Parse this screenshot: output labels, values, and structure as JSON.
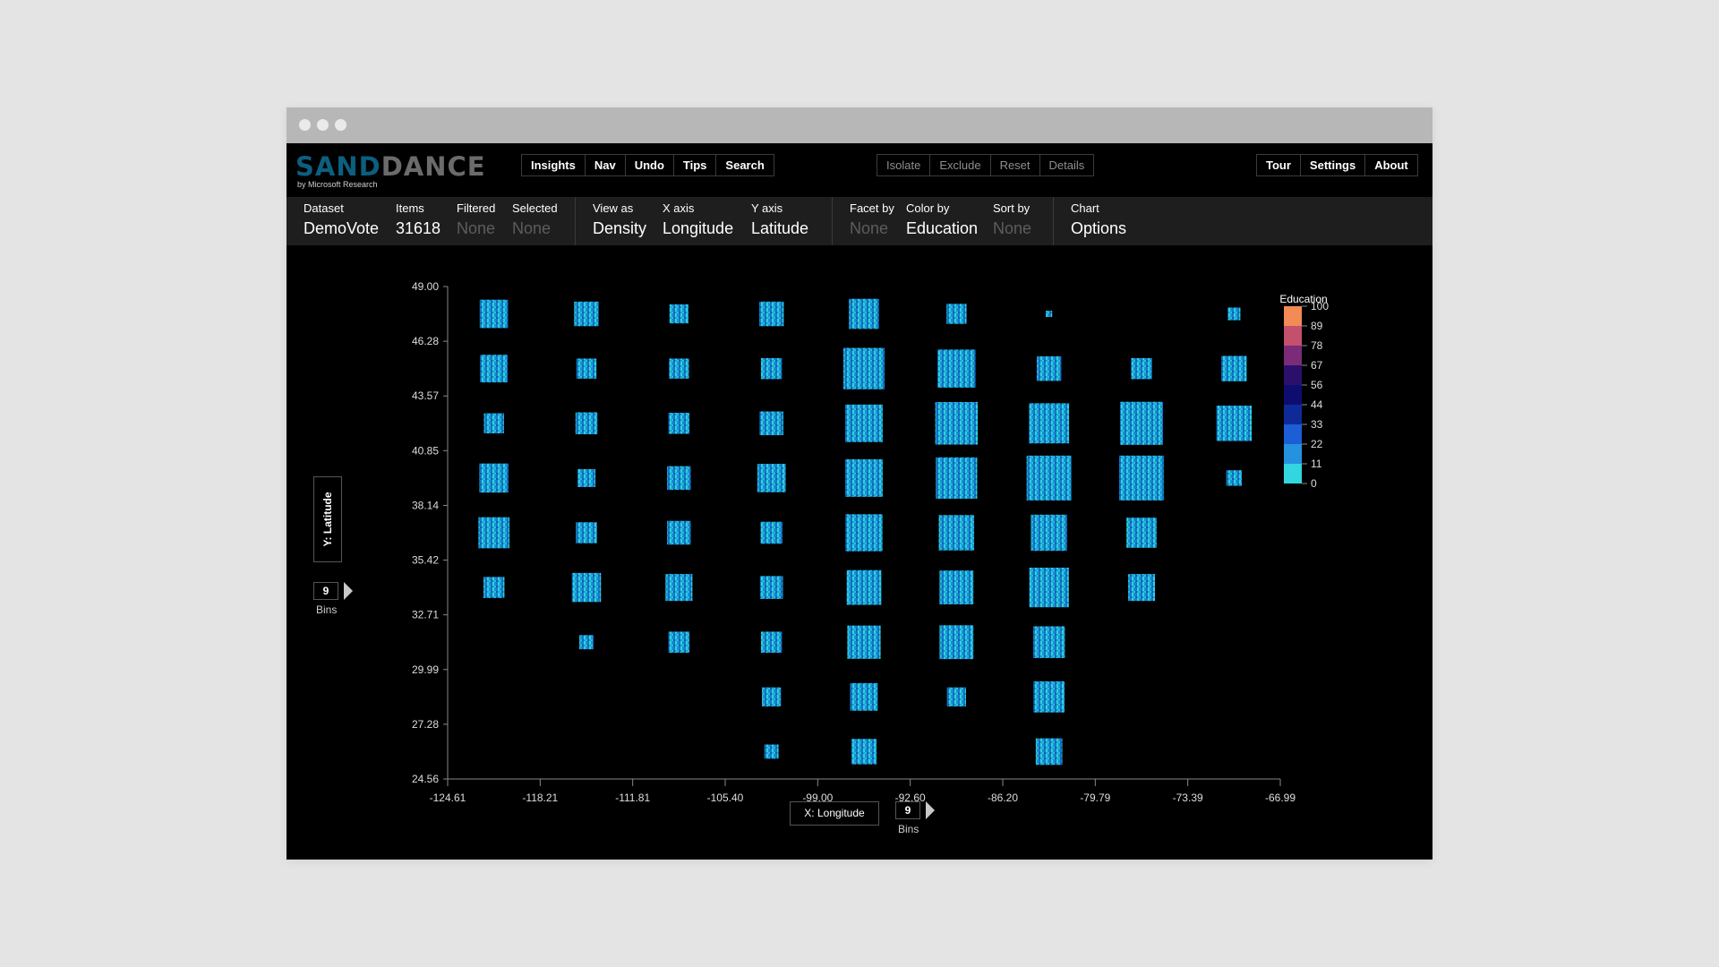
{
  "app": {
    "logo_part1": "SAND",
    "logo_part2": "DANCE",
    "logo_sub": "by Microsoft Research"
  },
  "nav_buttons": [
    "Insights",
    "Nav",
    "Undo",
    "Tips",
    "Search"
  ],
  "selection_buttons": [
    "Isolate",
    "Exclude",
    "Reset",
    "Details"
  ],
  "right_buttons": [
    "Tour",
    "Settings",
    "About"
  ],
  "toolbar": {
    "dataset": {
      "label": "Dataset",
      "value": "DemoVote"
    },
    "items": {
      "label": "Items",
      "value": "31618"
    },
    "filtered": {
      "label": "Filtered",
      "value": "None"
    },
    "selected": {
      "label": "Selected",
      "value": "None"
    },
    "view_as": {
      "label": "View as",
      "value": "Density"
    },
    "x_axis": {
      "label": "X axis",
      "value": "Longitude"
    },
    "y_axis": {
      "label": "Y axis",
      "value": "Latitude"
    },
    "facet_by": {
      "label": "Facet by",
      "value": "None"
    },
    "color_by": {
      "label": "Color by",
      "value": "Education"
    },
    "sort_by": {
      "label": "Sort by",
      "value": "None"
    },
    "chart": {
      "label": "Chart",
      "value": "Options"
    }
  },
  "axes": {
    "y_button": "Y: Latitude",
    "x_button": "X: Longitude",
    "y_bins": "9",
    "x_bins": "9",
    "bins_label": "Bins"
  },
  "colors": {
    "legend_scale": [
      "#f28b55",
      "#c4506e",
      "#7a2c78",
      "#2a106b",
      "#0d0d70",
      "#0f2a98",
      "#1c5ed6",
      "#2592e0",
      "#33d6e0"
    ]
  },
  "chart_data": {
    "type": "heatmap",
    "chart_style": "binned density squares",
    "xlabel": "X: Longitude",
    "ylabel": "Y: Latitude",
    "x_ticks": [
      "-124.61",
      "-118.21",
      "-111.81",
      "-105.40",
      "-99.00",
      "-92.60",
      "-86.20",
      "-79.79",
      "-73.39",
      "-66.99"
    ],
    "y_ticks": [
      "49.00",
      "46.28",
      "43.57",
      "40.85",
      "38.14",
      "35.42",
      "32.71",
      "29.99",
      "27.28",
      "24.56"
    ],
    "xlim": [
      -124.61,
      -66.99
    ],
    "ylim": [
      24.56,
      49.0
    ],
    "legend": {
      "title": "Education",
      "labels": [
        "100",
        "89",
        "78",
        "67",
        "56",
        "44",
        "33",
        "22",
        "11",
        "0"
      ]
    },
    "cells_note": "relative item density per bin, 0-1; row 0 = top latitude bin, col 0 = westmost bin",
    "cells": [
      [
        0.4,
        0.3,
        0.18,
        0.3,
        0.45,
        0.2,
        0.02,
        0.0,
        0.08
      ],
      [
        0.38,
        0.2,
        0.2,
        0.22,
        0.85,
        0.72,
        0.3,
        0.22,
        0.32
      ],
      [
        0.2,
        0.24,
        0.22,
        0.28,
        0.7,
        0.9,
        0.8,
        0.92,
        0.62
      ],
      [
        0.42,
        0.16,
        0.28,
        0.4,
        0.7,
        0.85,
        1.0,
        1.0,
        0.12
      ],
      [
        0.48,
        0.22,
        0.28,
        0.24,
        0.68,
        0.62,
        0.65,
        0.45,
        0.0
      ],
      [
        0.22,
        0.42,
        0.36,
        0.26,
        0.6,
        0.57,
        0.78,
        0.36,
        0.0
      ],
      [
        0.0,
        0.1,
        0.22,
        0.22,
        0.55,
        0.57,
        0.5,
        0.0,
        0.0
      ],
      [
        0.0,
        0.0,
        0.0,
        0.18,
        0.38,
        0.18,
        0.48,
        0.0,
        0.0
      ],
      [
        0.0,
        0.0,
        0.0,
        0.1,
        0.32,
        0.0,
        0.35,
        0.0,
        0.0
      ]
    ]
  }
}
